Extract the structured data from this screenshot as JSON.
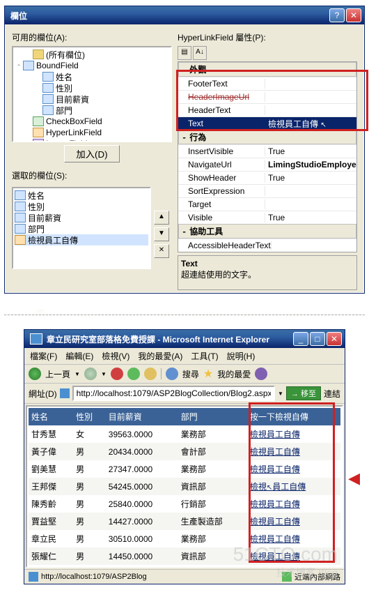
{
  "dialog": {
    "title": "欄位",
    "available_lbl": "可用的欄位(A):",
    "props_lbl": "HyperLinkField 屬性(P):",
    "selected_lbl": "選取的欄位(S):",
    "add_btn": "加入(D)",
    "tree": [
      {
        "icon": "fld",
        "label": "(所有欄位)",
        "ind": 1,
        "exp": ""
      },
      {
        "icon": "bf",
        "label": "BoundField",
        "ind": 0,
        "exp": "-"
      },
      {
        "icon": "bf",
        "label": "姓名",
        "ind": 2,
        "exp": ""
      },
      {
        "icon": "bf",
        "label": "性別",
        "ind": 2,
        "exp": ""
      },
      {
        "icon": "bf",
        "label": "目前薪資",
        "ind": 2,
        "exp": ""
      },
      {
        "icon": "bf",
        "label": "部門",
        "ind": 2,
        "exp": ""
      },
      {
        "icon": "cb",
        "label": "CheckBoxField",
        "ind": 1,
        "exp": ""
      },
      {
        "icon": "hl",
        "label": "HyperLinkField",
        "ind": 1,
        "exp": ""
      },
      {
        "icon": "img",
        "label": "ImageField",
        "ind": 1,
        "exp": ""
      }
    ],
    "selected": [
      {
        "icon": "bf",
        "label": "姓名"
      },
      {
        "icon": "bf",
        "label": "性別"
      },
      {
        "icon": "bf",
        "label": "目前薪資"
      },
      {
        "icon": "bf",
        "label": "部門"
      },
      {
        "icon": "hl",
        "label": "檢視員工自傳",
        "sel": true
      }
    ],
    "pg_cats": {
      "c1": "外觀",
      "c2": "行為",
      "c3": "協助工具"
    },
    "pg_rows": [
      {
        "n": "FooterText",
        "v": ""
      },
      {
        "n": "HeaderImageUrl",
        "v": "",
        "strike": true
      },
      {
        "n": "HeaderText",
        "v": ""
      },
      {
        "n": "Text",
        "v": "檢視員工自傳",
        "sel": true,
        "cursor": true
      }
    ],
    "pg_rows2": [
      {
        "n": "InsertVisible",
        "v": "True"
      },
      {
        "n": "NavigateUrl",
        "v": "LimingStudioEmploye",
        "bold": true
      },
      {
        "n": "ShowHeader",
        "v": "True"
      },
      {
        "n": "SortExpression",
        "v": ""
      },
      {
        "n": "Target",
        "v": ""
      },
      {
        "n": "Visible",
        "v": "True"
      }
    ],
    "pg_rows3": [
      {
        "n": "AccessibleHeaderText",
        "v": ""
      }
    ],
    "help_title": "Text",
    "help_desc": "超連結使用的文字。"
  },
  "browser": {
    "title": "章立民研究室部落格免費授課 - Microsoft Internet Explorer",
    "menus": [
      "檔案(F)",
      "編輯(E)",
      "檢視(V)",
      "我的最愛(A)",
      "工具(T)",
      "說明(H)"
    ],
    "tb_back": "上一頁",
    "tb_search": "搜尋",
    "tb_fav": "我的最愛",
    "addr_lbl": "網址(D)",
    "addr_url": "http://localhost:1079/ASP2BlogCollection/Blog2.aspx",
    "go": "移至",
    "links": "連結",
    "headers": [
      "姓名",
      "性別",
      "目前薪資",
      "部門",
      "按一下檢視自傳"
    ],
    "rows": [
      [
        "甘秀慧",
        "女",
        "39563.0000",
        "業務部"
      ],
      [
        "黃子偉",
        "男",
        "20434.0000",
        "會計部"
      ],
      [
        "劉美慧",
        "男",
        "27347.0000",
        "業務部"
      ],
      [
        "王邦傑",
        "男",
        "54245.0000",
        "資訊部"
      ],
      [
        "陳秀齡",
        "男",
        "25840.0000",
        "行銷部"
      ],
      [
        "賈益堅",
        "男",
        "14427.0000",
        "生產製造部"
      ],
      [
        "章立民",
        "男",
        "30510.0000",
        "業務部"
      ],
      [
        "張耀仁",
        "男",
        "14450.0000",
        "資訊部"
      ]
    ],
    "linktext": "檢視員工自傳",
    "status_left": "http://localhost:1079/ASP2Blog",
    "status_right": "近端內部網路"
  },
  "watermark": {
    "a": "51CTO.com",
    "b": "技术博客   Blog"
  }
}
